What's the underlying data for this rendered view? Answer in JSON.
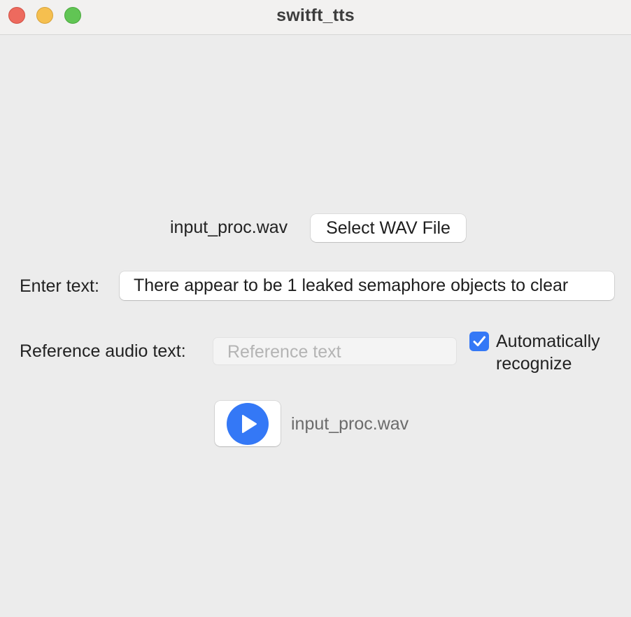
{
  "window": {
    "title": "switft_tts"
  },
  "file_select": {
    "selected_file": "input_proc.wav",
    "button_label": "Select WAV File"
  },
  "text_input": {
    "label": "Enter text:",
    "value": "There appear to be 1 leaked semaphore objects to clear"
  },
  "reference": {
    "label": "Reference audio text:",
    "placeholder": "Reference text",
    "auto_recognize": {
      "checked": true,
      "label": "Automatically recognize"
    }
  },
  "player": {
    "file_name": "input_proc.wav",
    "play_icon": "play-icon"
  },
  "colors": {
    "accent": "#3478f6",
    "close": "#ed6a5e",
    "minimize": "#f5bf4f",
    "zoom": "#61c554"
  }
}
